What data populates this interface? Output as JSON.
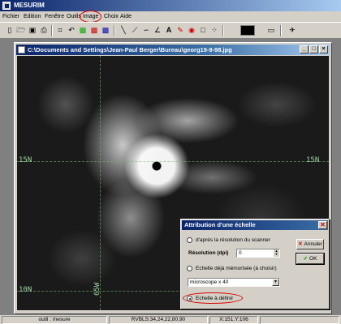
{
  "app": {
    "title": "MESURIM"
  },
  "menu": {
    "items": [
      "Fichier",
      "Edition",
      "Fenêtre",
      "Outils",
      "Image",
      "Choix",
      "Aide"
    ],
    "highlighted": "Image"
  },
  "toolbar": {
    "buttons": [
      "new-icon",
      "open-icon",
      "save-icon",
      "print-icon",
      "crop-icon",
      "undo-icon",
      "image-green-icon",
      "image-red-icon",
      "image-blue-icon",
      "line-icon",
      "polyline-icon",
      "curve-icon",
      "angle-icon",
      "text-icon",
      "color-picker-icon",
      "stamp-icon",
      "square-icon",
      "points-icon",
      "color-swatch",
      "select-icon",
      "plane-icon"
    ],
    "active_color": "#000000"
  },
  "document": {
    "title": "C:\\Documents and Settings\\Jean-Paul Berger\\Bureau\\georg19-9-98.jpg",
    "grid_labels": {
      "lat_15": "15N",
      "lat_15_right": "15N",
      "lat_10": "10N",
      "lon_65": "65W"
    }
  },
  "dialog": {
    "title": "Attribution d'une échelle",
    "option_scanner": "d'après la résolution du scanner",
    "resolution_label": "Résolution (dpi)",
    "resolution_value": "0",
    "option_memorized": "Echelle déjà mémorisée (à choisir)",
    "memorized_value": "microscope x 40",
    "option_define": "Echelle à définir",
    "selected_option": "define",
    "cancel_label": "Annuler",
    "ok_label": "OK",
    "highlight_color": "#dd0000"
  },
  "status": {
    "tool": "outil : mesure",
    "rvb": "RVBLS:34,24,22,80,90",
    "coords": "X:151,Y:106"
  }
}
